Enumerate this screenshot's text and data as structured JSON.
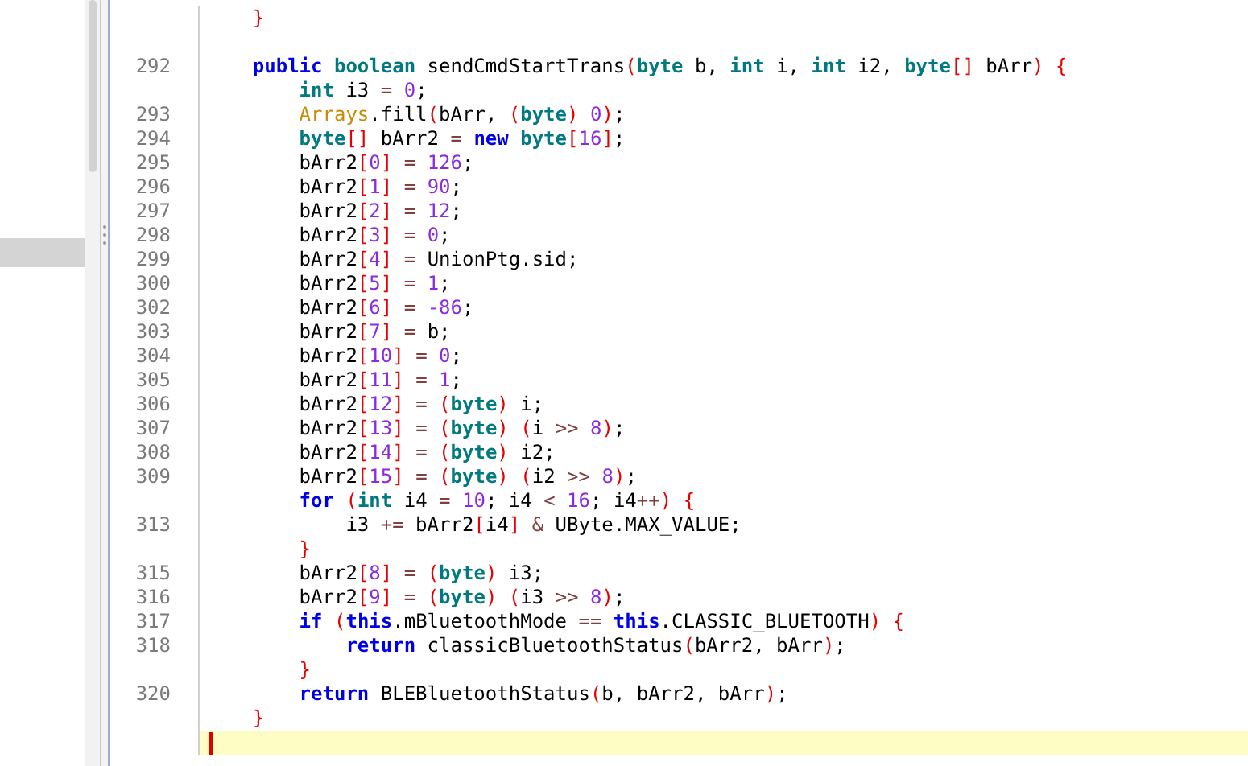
{
  "sidebar": {
    "highlighted_row": {
      "selected": true
    }
  },
  "editor": {
    "lines": [
      {
        "current": false,
        "segments": [
          {
            "text": "    }",
            "kind": "bracket"
          }
        ]
      },
      {
        "current": false
      },
      {
        "number": "292",
        "current": false,
        "segments": [
          {
            "text": "    public ",
            "kind": "keyword"
          },
          {
            "text": "boolean",
            "kind": "type"
          },
          {
            "text": " sendCmdStartTrans",
            "kind": "plain"
          },
          {
            "text": "(",
            "kind": "bracket"
          },
          {
            "text": "byte",
            "kind": "type"
          },
          {
            "text": " b, ",
            "kind": "plain"
          },
          {
            "text": "int",
            "kind": "type"
          },
          {
            "text": " i, ",
            "kind": "plain"
          },
          {
            "text": "int",
            "kind": "type"
          },
          {
            "text": " i2, ",
            "kind": "plain"
          },
          {
            "text": "byte",
            "kind": "type"
          },
          {
            "text": "[]",
            "kind": "bracket"
          },
          {
            "text": " bArr",
            "kind": "plain"
          },
          {
            "text": ")",
            "kind": "bracket"
          },
          {
            "text": " {",
            "kind": "bracket"
          }
        ]
      },
      {
        "current": false,
        "segments": [
          {
            "text": "        int",
            "kind": "type"
          },
          {
            "text": " i3 ",
            "kind": "plain"
          },
          {
            "text": "=",
            "kind": "operator"
          },
          {
            "text": " 0",
            "kind": "number"
          },
          {
            "text": ";",
            "kind": "plain"
          }
        ]
      },
      {
        "number": "293",
        "current": false,
        "segments": [
          {
            "text": "        Arrays",
            "kind": "class"
          },
          {
            "text": ".fill",
            "kind": "plain"
          },
          {
            "text": "(",
            "kind": "bracket"
          },
          {
            "text": "bArr, ",
            "kind": "plain"
          },
          {
            "text": "(",
            "kind": "bracket"
          },
          {
            "text": "byte",
            "kind": "type"
          },
          {
            "text": ")",
            "kind": "bracket"
          },
          {
            "text": " 0",
            "kind": "number"
          },
          {
            "text": ")",
            "kind": "bracket"
          },
          {
            "text": ";",
            "kind": "plain"
          }
        ]
      },
      {
        "number": "294",
        "current": false,
        "segments": [
          {
            "text": "        byte",
            "kind": "type"
          },
          {
            "text": "[]",
            "kind": "bracket"
          },
          {
            "text": " bArr2 ",
            "kind": "plain"
          },
          {
            "text": "=",
            "kind": "operator"
          },
          {
            "text": " new",
            "kind": "keyword"
          },
          {
            "text": " byte",
            "kind": "type"
          },
          {
            "text": "[",
            "kind": "bracket"
          },
          {
            "text": "16",
            "kind": "number"
          },
          {
            "text": "]",
            "kind": "bracket"
          },
          {
            "text": ";",
            "kind": "plain"
          }
        ]
      },
      {
        "number": "295",
        "current": false,
        "segments": [
          {
            "text": "        bArr2",
            "kind": "plain"
          },
          {
            "text": "[",
            "kind": "bracket"
          },
          {
            "text": "0",
            "kind": "number"
          },
          {
            "text": "]",
            "kind": "bracket"
          },
          {
            "text": " = ",
            "kind": "operator"
          },
          {
            "text": "126",
            "kind": "number"
          },
          {
            "text": ";",
            "kind": "plain"
          }
        ]
      },
      {
        "number": "296",
        "current": false,
        "segments": [
          {
            "text": "        bArr2",
            "kind": "plain"
          },
          {
            "text": "[",
            "kind": "bracket"
          },
          {
            "text": "1",
            "kind": "number"
          },
          {
            "text": "]",
            "kind": "bracket"
          },
          {
            "text": " = ",
            "kind": "operator"
          },
          {
            "text": "90",
            "kind": "number"
          },
          {
            "text": ";",
            "kind": "plain"
          }
        ]
      },
      {
        "number": "297",
        "current": false,
        "segments": [
          {
            "text": "        bArr2",
            "kind": "plain"
          },
          {
            "text": "[",
            "kind": "bracket"
          },
          {
            "text": "2",
            "kind": "number"
          },
          {
            "text": "]",
            "kind": "bracket"
          },
          {
            "text": " = ",
            "kind": "operator"
          },
          {
            "text": "12",
            "kind": "number"
          },
          {
            "text": ";",
            "kind": "plain"
          }
        ]
      },
      {
        "number": "298",
        "current": false,
        "segments": [
          {
            "text": "        bArr2",
            "kind": "plain"
          },
          {
            "text": "[",
            "kind": "bracket"
          },
          {
            "text": "3",
            "kind": "number"
          },
          {
            "text": "]",
            "kind": "bracket"
          },
          {
            "text": " = ",
            "kind": "operator"
          },
          {
            "text": "0",
            "kind": "number"
          },
          {
            "text": ";",
            "kind": "plain"
          }
        ]
      },
      {
        "number": "299",
        "current": false,
        "segments": [
          {
            "text": "        bArr2",
            "kind": "plain"
          },
          {
            "text": "[",
            "kind": "bracket"
          },
          {
            "text": "4",
            "kind": "number"
          },
          {
            "text": "]",
            "kind": "bracket"
          },
          {
            "text": " = ",
            "kind": "operator"
          },
          {
            "text": "UnionPtg.sid;",
            "kind": "plain"
          }
        ]
      },
      {
        "number": "300",
        "current": false,
        "segments": [
          {
            "text": "        bArr2",
            "kind": "plain"
          },
          {
            "text": "[",
            "kind": "bracket"
          },
          {
            "text": "5",
            "kind": "number"
          },
          {
            "text": "]",
            "kind": "bracket"
          },
          {
            "text": " = ",
            "kind": "operator"
          },
          {
            "text": "1",
            "kind": "number"
          },
          {
            "text": ";",
            "kind": "plain"
          }
        ]
      },
      {
        "number": "302",
        "current": false,
        "segments": [
          {
            "text": "        bArr2",
            "kind": "plain"
          },
          {
            "text": "[",
            "kind": "bracket"
          },
          {
            "text": "6",
            "kind": "number"
          },
          {
            "text": "]",
            "kind": "bracket"
          },
          {
            "text": " = ",
            "kind": "operator"
          },
          {
            "text": "-86",
            "kind": "number"
          },
          {
            "text": ";",
            "kind": "plain"
          }
        ]
      },
      {
        "number": "303",
        "current": false,
        "segments": [
          {
            "text": "        bArr2",
            "kind": "plain"
          },
          {
            "text": "[",
            "kind": "bracket"
          },
          {
            "text": "7",
            "kind": "number"
          },
          {
            "text": "]",
            "kind": "bracket"
          },
          {
            "text": " = ",
            "kind": "operator"
          },
          {
            "text": "b;",
            "kind": "plain"
          }
        ]
      },
      {
        "number": "304",
        "current": false,
        "segments": [
          {
            "text": "        bArr2",
            "kind": "plain"
          },
          {
            "text": "[",
            "kind": "bracket"
          },
          {
            "text": "10",
            "kind": "number"
          },
          {
            "text": "]",
            "kind": "bracket"
          },
          {
            "text": " = ",
            "kind": "operator"
          },
          {
            "text": "0",
            "kind": "number"
          },
          {
            "text": ";",
            "kind": "plain"
          }
        ]
      },
      {
        "number": "305",
        "current": false,
        "segments": [
          {
            "text": "        bArr2",
            "kind": "plain"
          },
          {
            "text": "[",
            "kind": "bracket"
          },
          {
            "text": "11",
            "kind": "number"
          },
          {
            "text": "]",
            "kind": "bracket"
          },
          {
            "text": " = ",
            "kind": "operator"
          },
          {
            "text": "1",
            "kind": "number"
          },
          {
            "text": ";",
            "kind": "plain"
          }
        ]
      },
      {
        "number": "306",
        "current": false,
        "segments": [
          {
            "text": "        bArr2",
            "kind": "plain"
          },
          {
            "text": "[",
            "kind": "bracket"
          },
          {
            "text": "12",
            "kind": "number"
          },
          {
            "text": "]",
            "kind": "bracket"
          },
          {
            "text": " = ",
            "kind": "operator"
          },
          {
            "text": "(",
            "kind": "bracket"
          },
          {
            "text": "byte",
            "kind": "type"
          },
          {
            "text": ")",
            "kind": "bracket"
          },
          {
            "text": " i;",
            "kind": "plain"
          }
        ]
      },
      {
        "number": "307",
        "current": false,
        "segments": [
          {
            "text": "        bArr2",
            "kind": "plain"
          },
          {
            "text": "[",
            "kind": "bracket"
          },
          {
            "text": "13",
            "kind": "number"
          },
          {
            "text": "]",
            "kind": "bracket"
          },
          {
            "text": " = ",
            "kind": "operator"
          },
          {
            "text": "(",
            "kind": "bracket"
          },
          {
            "text": "byte",
            "kind": "type"
          },
          {
            "text": ") ",
            "kind": "bracket"
          },
          {
            "text": "(",
            "kind": "bracket"
          },
          {
            "text": "i ",
            "kind": "plain"
          },
          {
            "text": ">>",
            "kind": "operator"
          },
          {
            "text": " 8",
            "kind": "number"
          },
          {
            "text": ")",
            "kind": "bracket"
          },
          {
            "text": ";",
            "kind": "plain"
          }
        ]
      },
      {
        "number": "308",
        "current": false,
        "segments": [
          {
            "text": "        bArr2",
            "kind": "plain"
          },
          {
            "text": "[",
            "kind": "bracket"
          },
          {
            "text": "14",
            "kind": "number"
          },
          {
            "text": "]",
            "kind": "bracket"
          },
          {
            "text": " = ",
            "kind": "operator"
          },
          {
            "text": "(",
            "kind": "bracket"
          },
          {
            "text": "byte",
            "kind": "type"
          },
          {
            "text": ")",
            "kind": "bracket"
          },
          {
            "text": " i2;",
            "kind": "plain"
          }
        ]
      },
      {
        "number": "309",
        "current": false,
        "segments": [
          {
            "text": "        bArr2",
            "kind": "plain"
          },
          {
            "text": "[",
            "kind": "bracket"
          },
          {
            "text": "15",
            "kind": "number"
          },
          {
            "text": "]",
            "kind": "bracket"
          },
          {
            "text": " = ",
            "kind": "operator"
          },
          {
            "text": "(",
            "kind": "bracket"
          },
          {
            "text": "byte",
            "kind": "type"
          },
          {
            "text": ") ",
            "kind": "bracket"
          },
          {
            "text": "(",
            "kind": "bracket"
          },
          {
            "text": "i2 ",
            "kind": "plain"
          },
          {
            "text": ">>",
            "kind": "operator"
          },
          {
            "text": " 8",
            "kind": "number"
          },
          {
            "text": ")",
            "kind": "bracket"
          },
          {
            "text": ";",
            "kind": "plain"
          }
        ]
      },
      {
        "current": false,
        "segments": [
          {
            "text": "        for ",
            "kind": "keyword"
          },
          {
            "text": "(",
            "kind": "bracket"
          },
          {
            "text": "int",
            "kind": "type"
          },
          {
            "text": " i4 ",
            "kind": "plain"
          },
          {
            "text": "=",
            "kind": "operator"
          },
          {
            "text": " 10",
            "kind": "number"
          },
          {
            "text": "; i4 ",
            "kind": "plain"
          },
          {
            "text": "<",
            "kind": "operator"
          },
          {
            "text": " 16",
            "kind": "number"
          },
          {
            "text": "; i4",
            "kind": "plain"
          },
          {
            "text": "++",
            "kind": "operator"
          },
          {
            "text": ")",
            "kind": "bracket"
          },
          {
            "text": " {",
            "kind": "bracket"
          }
        ]
      },
      {
        "number": "313",
        "current": false,
        "segments": [
          {
            "text": "            i3 ",
            "kind": "plain"
          },
          {
            "text": "+=",
            "kind": "operator"
          },
          {
            "text": " bArr2",
            "kind": "plain"
          },
          {
            "text": "[",
            "kind": "bracket"
          },
          {
            "text": "i4",
            "kind": "plain"
          },
          {
            "text": "] ",
            "kind": "bracket"
          },
          {
            "text": "&",
            "kind": "operator"
          },
          {
            "text": " UByte.MAX_VALUE;",
            "kind": "plain"
          }
        ]
      },
      {
        "current": false,
        "segments": [
          {
            "text": "        }",
            "kind": "bracket"
          }
        ]
      },
      {
        "number": "315",
        "current": false,
        "segments": [
          {
            "text": "        bArr2",
            "kind": "plain"
          },
          {
            "text": "[",
            "kind": "bracket"
          },
          {
            "text": "8",
            "kind": "number"
          },
          {
            "text": "]",
            "kind": "bracket"
          },
          {
            "text": " = ",
            "kind": "operator"
          },
          {
            "text": "(",
            "kind": "bracket"
          },
          {
            "text": "byte",
            "kind": "type"
          },
          {
            "text": ")",
            "kind": "bracket"
          },
          {
            "text": " i3;",
            "kind": "plain"
          }
        ]
      },
      {
        "number": "316",
        "current": false,
        "segments": [
          {
            "text": "        bArr2",
            "kind": "plain"
          },
          {
            "text": "[",
            "kind": "bracket"
          },
          {
            "text": "9",
            "kind": "number"
          },
          {
            "text": "]",
            "kind": "bracket"
          },
          {
            "text": " = ",
            "kind": "operator"
          },
          {
            "text": "(",
            "kind": "bracket"
          },
          {
            "text": "byte",
            "kind": "type"
          },
          {
            "text": ") ",
            "kind": "bracket"
          },
          {
            "text": "(",
            "kind": "bracket"
          },
          {
            "text": "i3 ",
            "kind": "plain"
          },
          {
            "text": ">>",
            "kind": "operator"
          },
          {
            "text": " 8",
            "kind": "number"
          },
          {
            "text": ")",
            "kind": "bracket"
          },
          {
            "text": ";",
            "kind": "plain"
          }
        ]
      },
      {
        "number": "317",
        "current": false,
        "segments": [
          {
            "text": "        if ",
            "kind": "keyword"
          },
          {
            "text": "(",
            "kind": "bracket"
          },
          {
            "text": "this",
            "kind": "keyword"
          },
          {
            "text": ".mBluetoothMode ",
            "kind": "plain"
          },
          {
            "text": "==",
            "kind": "operator"
          },
          {
            "text": " this",
            "kind": "keyword"
          },
          {
            "text": ".CLASSIC_BLUETOOTH",
            "kind": "plain"
          },
          {
            "text": ")",
            "kind": "bracket"
          },
          {
            "text": " {",
            "kind": "bracket"
          }
        ]
      },
      {
        "number": "318",
        "current": false,
        "segments": [
          {
            "text": "            return",
            "kind": "keyword"
          },
          {
            "text": " classicBluetoothStatus",
            "kind": "plain"
          },
          {
            "text": "(",
            "kind": "bracket"
          },
          {
            "text": "bArr2, bArr",
            "kind": "plain"
          },
          {
            "text": ")",
            "kind": "bracket"
          },
          {
            "text": ";",
            "kind": "plain"
          }
        ]
      },
      {
        "current": false,
        "segments": [
          {
            "text": "        }",
            "kind": "bracket"
          }
        ]
      },
      {
        "number": "320",
        "current": false,
        "segments": [
          {
            "text": "        return",
            "kind": "keyword"
          },
          {
            "text": " BLEBluetoothStatus",
            "kind": "plain"
          },
          {
            "text": "(",
            "kind": "bracket"
          },
          {
            "text": "b, bArr2, bArr",
            "kind": "plain"
          },
          {
            "text": ")",
            "kind": "bracket"
          },
          {
            "text": ";",
            "kind": "plain"
          }
        ]
      },
      {
        "current": false,
        "segments": [
          {
            "text": "    }",
            "kind": "bracket"
          }
        ]
      },
      {
        "current": true
      }
    ]
  }
}
